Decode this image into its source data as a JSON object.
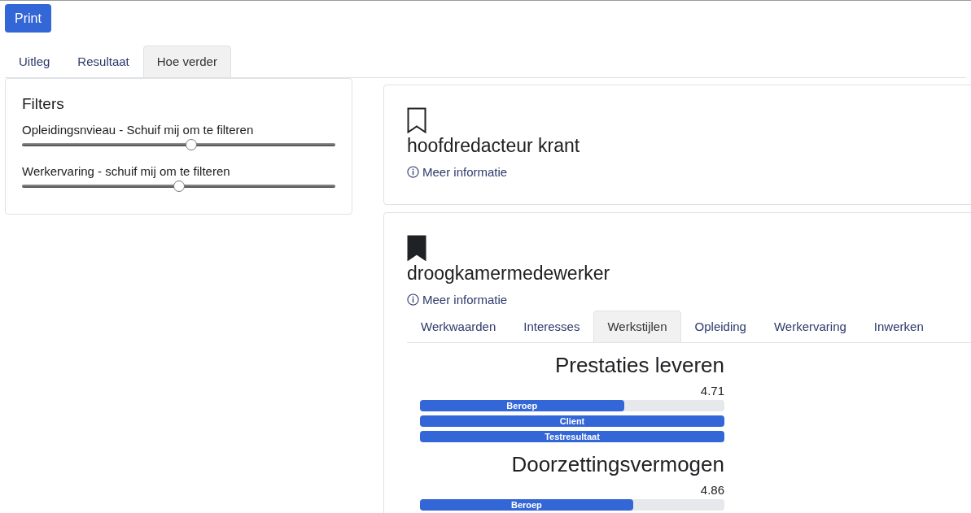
{
  "print_button": "Print",
  "tabs": [
    {
      "label": "Uitleg",
      "selected": false
    },
    {
      "label": "Resultaat",
      "selected": false
    },
    {
      "label": "Hoe verder",
      "selected": true
    }
  ],
  "filters": {
    "title": "Filters",
    "sliders": [
      {
        "label": "Opleidingsnvieau - Schuif mij om te filteren",
        "level": 0.54
      },
      {
        "label": "Werkervaring - schuif mij om te filteren",
        "level": 0.5
      }
    ]
  },
  "jobs": [
    {
      "title": "hoofdredacteur krant",
      "bookmarked": false,
      "info_link": "Meer informatie"
    },
    {
      "title": "droogkamermedewerker",
      "bookmarked": true,
      "info_link": "Meer informatie",
      "tabs": [
        {
          "label": "Werkwaarden",
          "selected": false
        },
        {
          "label": "Interesses",
          "selected": false
        },
        {
          "label": "Werkstijlen",
          "selected": true
        },
        {
          "label": "Opleiding",
          "selected": false
        },
        {
          "label": "Werkervaring",
          "selected": false
        },
        {
          "label": "Inwerken",
          "selected": false
        }
      ],
      "styles": [
        {
          "name": "Prestaties leveren",
          "score": "4.71",
          "bars": [
            {
              "label": "Beroep",
              "level": 0.67
            },
            {
              "label": "Client",
              "level": 1
            },
            {
              "label": "Testresultaat",
              "level": 1
            }
          ]
        },
        {
          "name": "Doorzettingsvermogen",
          "score": "4.86",
          "bars": [
            {
              "label": "Beroep",
              "level": 0.7
            }
          ]
        }
      ]
    }
  ]
}
